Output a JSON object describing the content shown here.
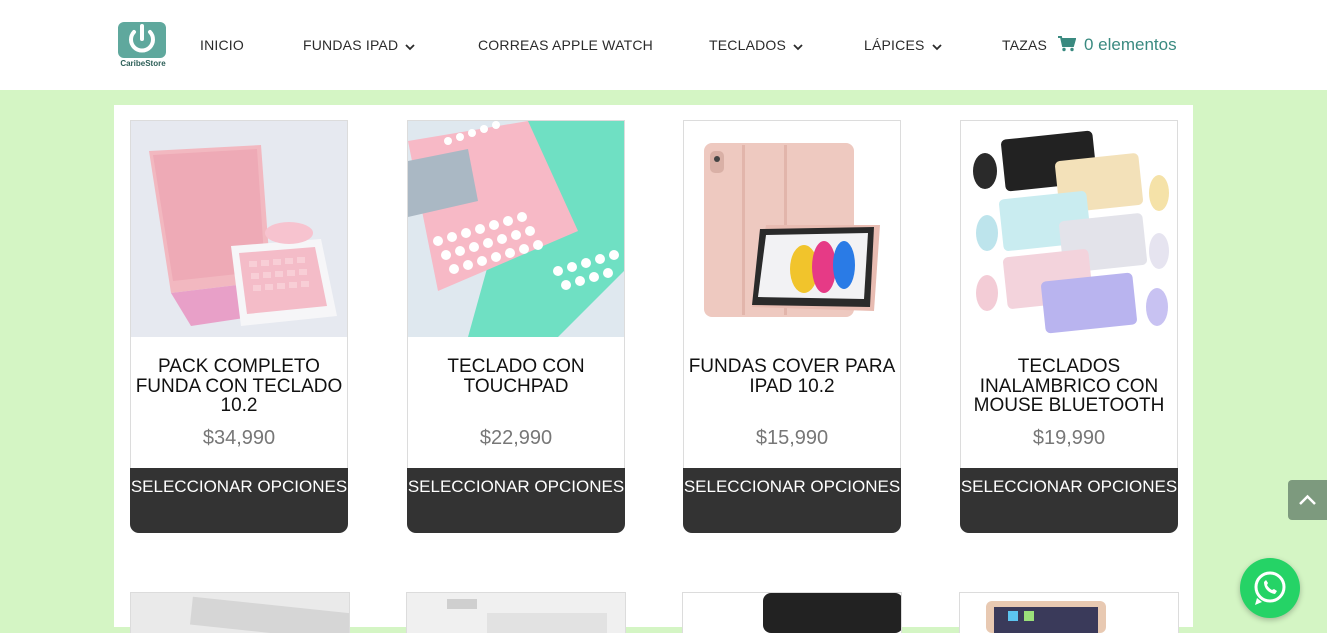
{
  "brand": {
    "logo_text": "CaribeStore",
    "accent": "#3a8a80",
    "background": "#d4f5c4"
  },
  "nav": {
    "items": [
      {
        "label": "INICIO",
        "dropdown": false
      },
      {
        "label": "FUNDAS IPAD",
        "dropdown": true
      },
      {
        "label": "CORREAS APPLE WATCH",
        "dropdown": false
      },
      {
        "label": "TECLADOS",
        "dropdown": true
      },
      {
        "label": "LÁPICES",
        "dropdown": true
      },
      {
        "label": "TAZAS",
        "dropdown": false
      }
    ],
    "cart_label": "0 elementos",
    "cart_icon": "shopping-cart-icon"
  },
  "products": [
    {
      "title": "PACK COMPLETO FUNDA CON TECLADO 10.2",
      "price": "$34,990",
      "button": "SELECCIONAR OPCIONES"
    },
    {
      "title": "TECLADO CON TOUCHPAD",
      "price": "$22,990",
      "button": "SELECCIONAR OPCIONES"
    },
    {
      "title": "FUNDAS COVER PARA IPAD 10.2",
      "price": "$15,990",
      "button": "SELECCIONAR OPCIONES"
    },
    {
      "title": "TECLADOS INALAMBRICO CON MOUSE BLUETOOTH",
      "price": "$19,990",
      "button": "SELECCIONAR OPCIONES"
    }
  ],
  "floating": {
    "scroll_top_icon": "chevron-up-icon",
    "whatsapp_icon": "whatsapp-icon",
    "whatsapp_color": "#25d366"
  }
}
